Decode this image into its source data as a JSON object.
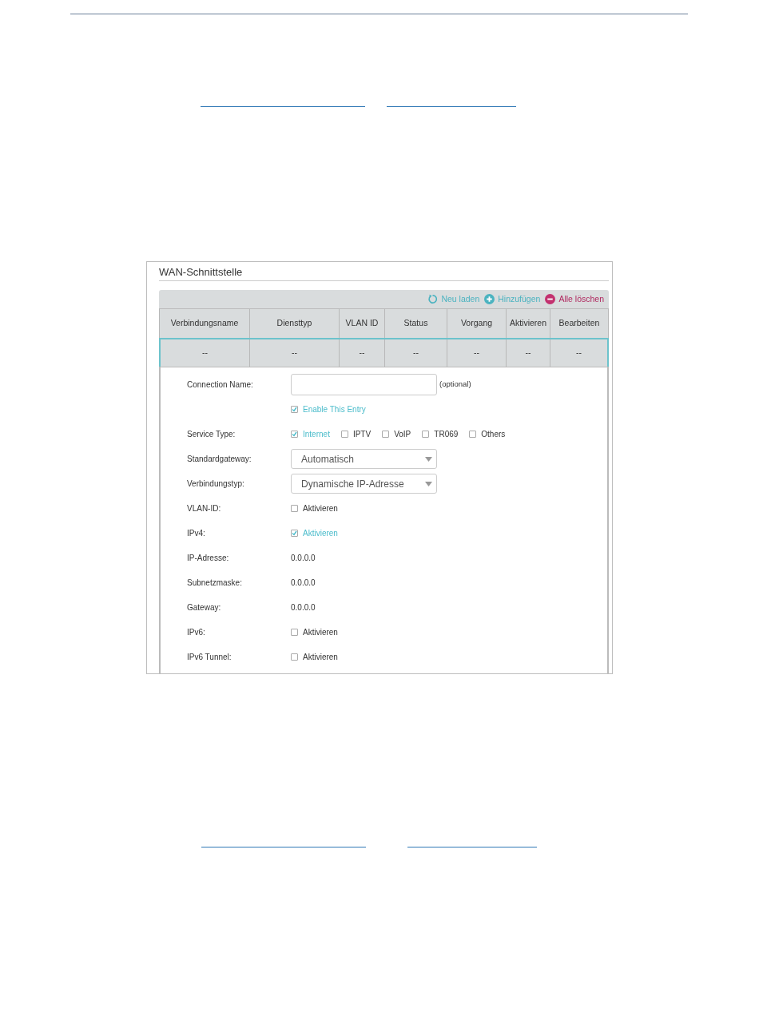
{
  "panel": {
    "title": "WAN-Schnittstelle",
    "toolbar": [
      {
        "kind": "reload",
        "label": "Neu laden"
      },
      {
        "kind": "add",
        "label": "Hinzufügen"
      },
      {
        "kind": "delete_all",
        "label": "Alle löschen"
      }
    ],
    "table": {
      "columns": [
        "Verbindungsname",
        "Diensttyp",
        "VLAN ID",
        "Status",
        "Vorgang",
        "Aktivieren",
        "Bearbeiten"
      ],
      "rows": [
        [
          "--",
          "--",
          "--",
          "--",
          "--",
          "--",
          "--"
        ]
      ]
    },
    "form": [
      {
        "kind": "input",
        "label": "Connection Name:",
        "note": "(optional)"
      },
      {
        "kind": "checks",
        "options": [
          {
            "label": "Enable This Entry",
            "checked": true
          }
        ]
      },
      {
        "kind": "checks",
        "label": "Service Type:",
        "options": [
          {
            "label": "Internet",
            "checked": true
          },
          {
            "label": "IPTV",
            "checked": false
          },
          {
            "label": "VoIP",
            "checked": false
          },
          {
            "label": "TR069",
            "checked": false
          },
          {
            "label": "Others",
            "checked": false
          }
        ]
      },
      {
        "kind": "select",
        "label": "Standardgateway:",
        "value": "Automatisch"
      },
      {
        "kind": "select",
        "label": "Verbindungstyp:",
        "value": "Dynamische IP-Adresse"
      },
      {
        "kind": "checks",
        "label": "VLAN-ID:",
        "options": [
          {
            "label": "Aktivieren",
            "checked": false
          }
        ]
      },
      {
        "kind": "checks",
        "label": "IPv4:",
        "options": [
          {
            "label": "Aktivieren",
            "checked": true
          }
        ]
      },
      {
        "kind": "value",
        "label": "IP-Adresse:",
        "value": "0.0.0.0"
      },
      {
        "kind": "value",
        "label": "Subnetzmaske:",
        "value": "0.0.0.0"
      },
      {
        "kind": "value",
        "label": "Gateway:",
        "value": "0.0.0.0"
      },
      {
        "kind": "checks",
        "label": "IPv6:",
        "options": [
          {
            "label": "Aktivieren",
            "checked": false
          }
        ]
      },
      {
        "kind": "checks",
        "label": "IPv6 Tunnel:",
        "options": [
          {
            "label": "Aktivieren",
            "checked": false
          }
        ]
      }
    ]
  }
}
